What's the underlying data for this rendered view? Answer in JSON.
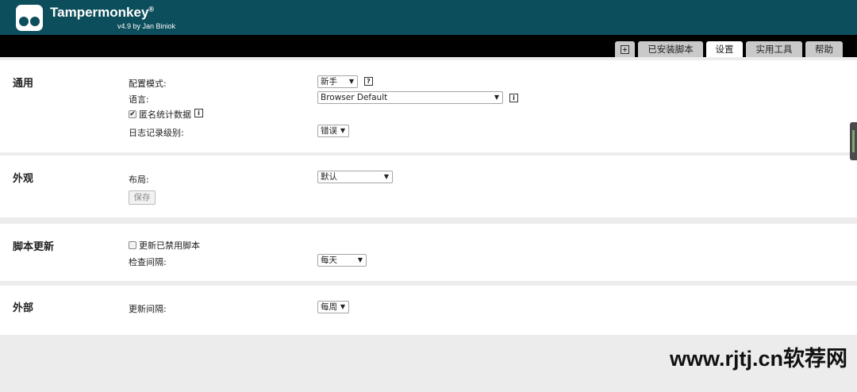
{
  "header": {
    "title": "Tampermonkey",
    "registered": "®",
    "subtitle": "v4.9 by Jan Biniok"
  },
  "tabs": {
    "new_icon": "plus-square-icon",
    "installed": "已安装脚本",
    "settings": "设置",
    "utilities": "实用工具",
    "help": "帮助",
    "active": "设置"
  },
  "general": {
    "title": "通用",
    "config_mode_label": "配置模式:",
    "config_mode_value": "新手",
    "language_label": "语言:",
    "language_value": "Browser Default",
    "anon_stats_label": "匿名统计数据",
    "anon_stats_checked": true,
    "log_level_label": "日志记录级别:",
    "log_level_value": "错误"
  },
  "appearance": {
    "title": "外观",
    "layout_label": "布局:",
    "layout_value": "默认",
    "save_label": "保存"
  },
  "script_update": {
    "title": "脚本更新",
    "update_disabled_label": "更新已禁用脚本",
    "update_disabled_checked": false,
    "check_interval_label": "检查间隔:",
    "check_interval_value": "每天"
  },
  "external": {
    "title": "外部",
    "update_interval_label": "更新间隔:",
    "update_interval_value": "每周"
  },
  "icons": {
    "help_glyph": "?",
    "info_glyph": "i",
    "check_glyph": "✔",
    "caret_glyph": "▼"
  },
  "watermark": "www.rjtj.cn软荐网",
  "colors": {
    "header_bg": "#0d4e5c",
    "tabbar_bg": "#000000",
    "tab_bg": "#c9c9c9",
    "active_tab_bg": "#ffffff",
    "page_bg": "#ececec"
  }
}
